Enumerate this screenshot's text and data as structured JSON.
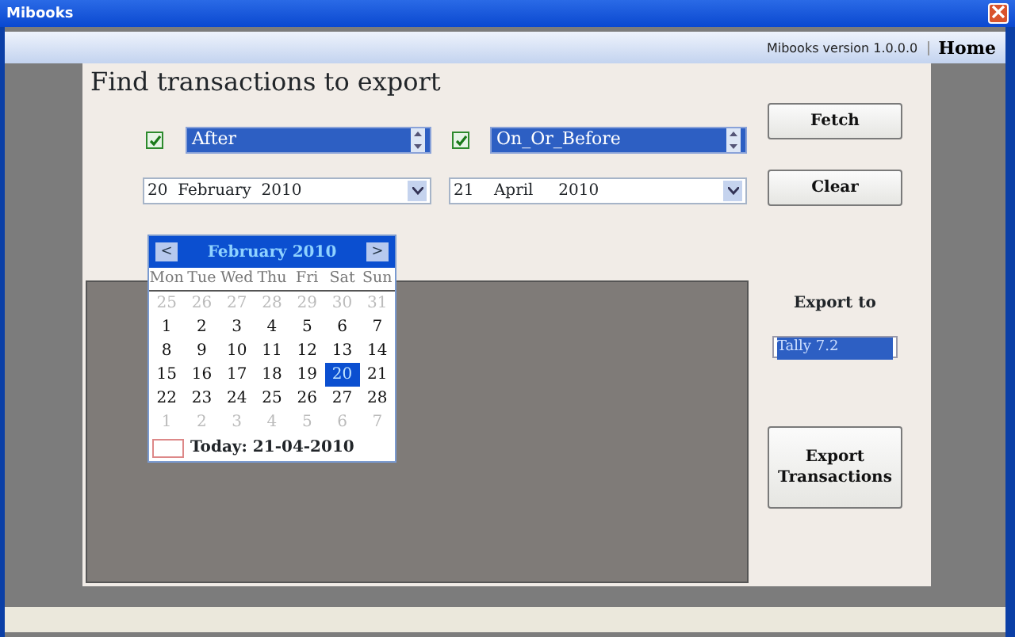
{
  "window": {
    "title": "Mibooks"
  },
  "toolbar": {
    "version": "Mibooks version 1.0.0.0",
    "home": "Home"
  },
  "heading": "Find transactions to export",
  "filters": [
    {
      "checked": true,
      "mode": "After",
      "date": "20  February  2010"
    },
    {
      "checked": true,
      "mode": "On_Or_Before",
      "date": "21    April     2010"
    }
  ],
  "fetch_button": "Fetch",
  "clear_button": "Clear",
  "calendar": {
    "prev": "<",
    "next": ">",
    "month": "February 2010",
    "weekdays": [
      "Mon",
      "Tue",
      "Wed",
      "Thu",
      "Fri",
      "Sat",
      "Sun"
    ],
    "weeks": [
      [
        {
          "day": "25",
          "muted": true,
          "selected": false
        },
        {
          "day": "26",
          "muted": true,
          "selected": false
        },
        {
          "day": "27",
          "muted": true,
          "selected": false
        },
        {
          "day": "28",
          "muted": true,
          "selected": false
        },
        {
          "day": "29",
          "muted": true,
          "selected": false
        },
        {
          "day": "30",
          "muted": true,
          "selected": false
        },
        {
          "day": "31",
          "muted": true,
          "selected": false
        }
      ],
      [
        {
          "day": "1",
          "muted": false,
          "selected": false
        },
        {
          "day": "2",
          "muted": false,
          "selected": false
        },
        {
          "day": "3",
          "muted": false,
          "selected": false
        },
        {
          "day": "4",
          "muted": false,
          "selected": false
        },
        {
          "day": "5",
          "muted": false,
          "selected": false
        },
        {
          "day": "6",
          "muted": false,
          "selected": false
        },
        {
          "day": "7",
          "muted": false,
          "selected": false
        }
      ],
      [
        {
          "day": "8",
          "muted": false,
          "selected": false
        },
        {
          "day": "9",
          "muted": false,
          "selected": false
        },
        {
          "day": "10",
          "muted": false,
          "selected": false
        },
        {
          "day": "11",
          "muted": false,
          "selected": false
        },
        {
          "day": "12",
          "muted": false,
          "selected": false
        },
        {
          "day": "13",
          "muted": false,
          "selected": false
        },
        {
          "day": "14",
          "muted": false,
          "selected": false
        }
      ],
      [
        {
          "day": "15",
          "muted": false,
          "selected": false
        },
        {
          "day": "16",
          "muted": false,
          "selected": false
        },
        {
          "day": "17",
          "muted": false,
          "selected": false
        },
        {
          "day": "18",
          "muted": false,
          "selected": false
        },
        {
          "day": "19",
          "muted": false,
          "selected": false
        },
        {
          "day": "20",
          "muted": false,
          "selected": true
        },
        {
          "day": "21",
          "muted": false,
          "selected": false
        }
      ],
      [
        {
          "day": "22",
          "muted": false,
          "selected": false
        },
        {
          "day": "23",
          "muted": false,
          "selected": false
        },
        {
          "day": "24",
          "muted": false,
          "selected": false
        },
        {
          "day": "25",
          "muted": false,
          "selected": false
        },
        {
          "day": "26",
          "muted": false,
          "selected": false
        },
        {
          "day": "27",
          "muted": false,
          "selected": false
        },
        {
          "day": "28",
          "muted": false,
          "selected": false
        }
      ],
      [
        {
          "day": "1",
          "muted": true,
          "selected": false
        },
        {
          "day": "2",
          "muted": true,
          "selected": false
        },
        {
          "day": "3",
          "muted": true,
          "selected": false
        },
        {
          "day": "4",
          "muted": true,
          "selected": false
        },
        {
          "day": "5",
          "muted": true,
          "selected": false
        },
        {
          "day": "6",
          "muted": true,
          "selected": false
        },
        {
          "day": "7",
          "muted": true,
          "selected": false
        }
      ]
    ],
    "today": "Today: 21-04-2010"
  },
  "export": {
    "label": "Export to",
    "targets": [
      {
        "label": "Tally 7.2",
        "selected": true
      }
    ],
    "button": "Export\nTransactions"
  }
}
